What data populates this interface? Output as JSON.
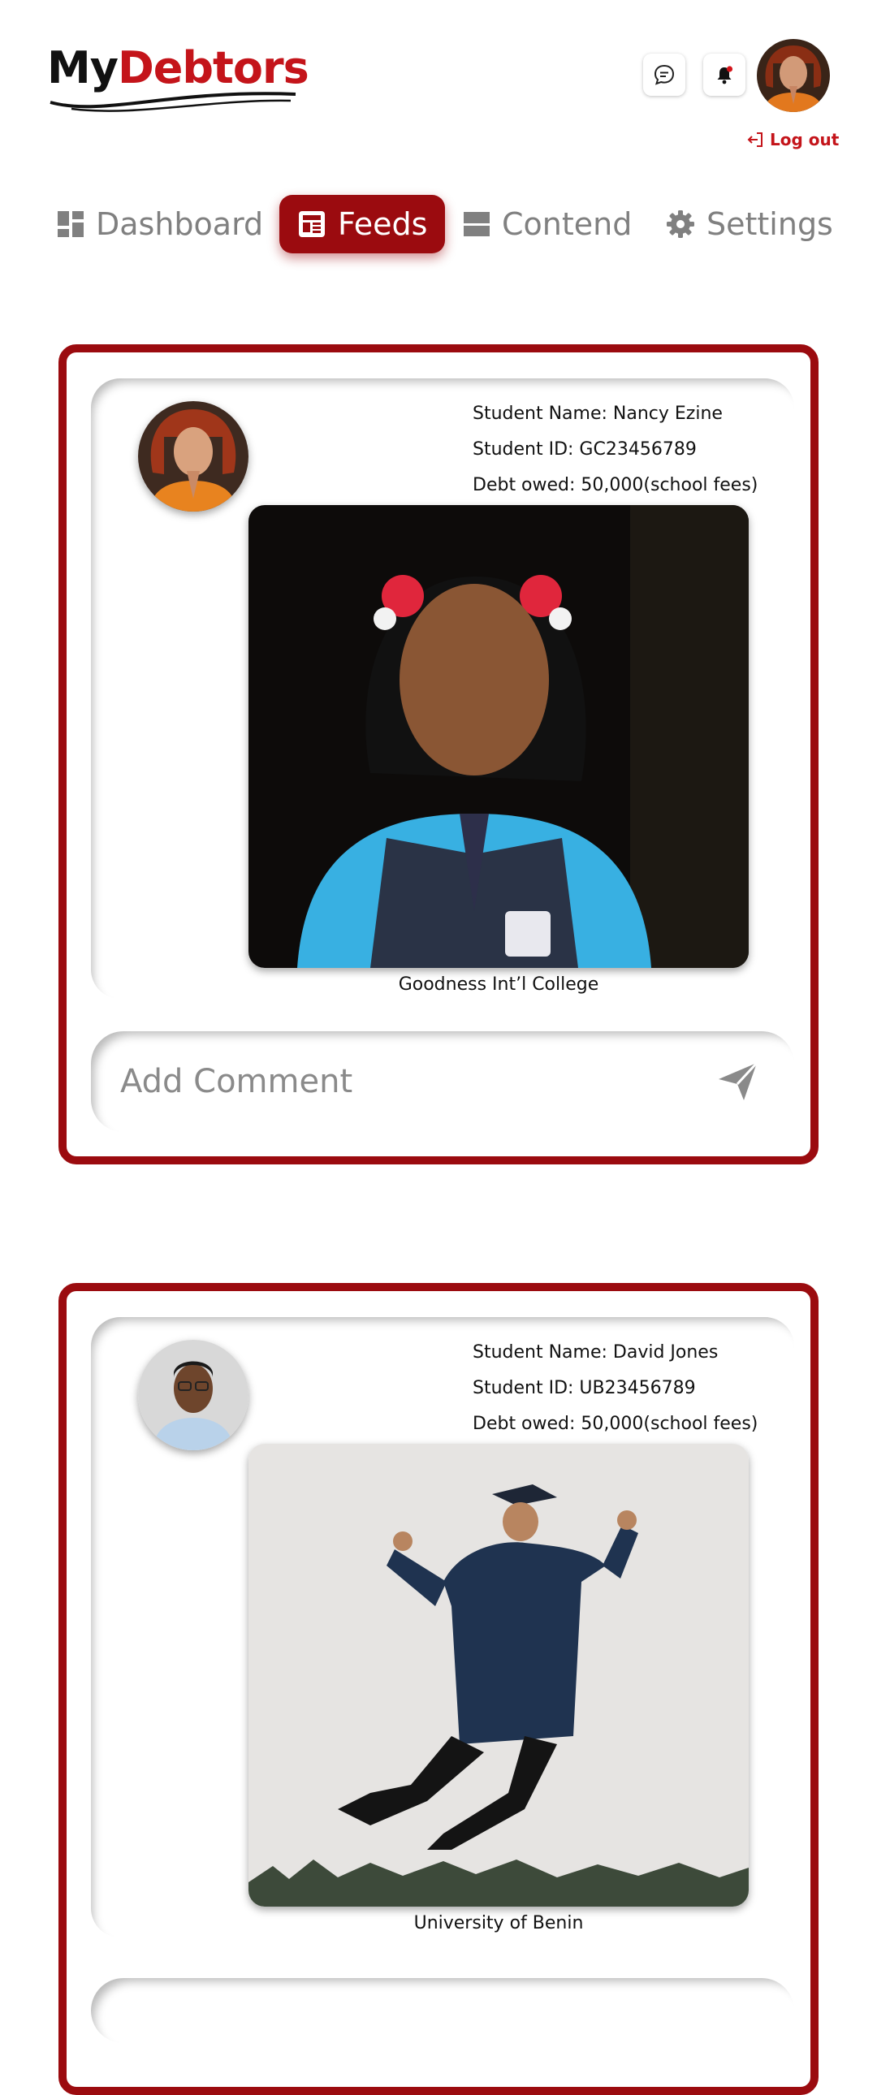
{
  "header": {
    "logo_my": "My",
    "logo_debtors": "Debtors",
    "logout_label": "Log out"
  },
  "nav": {
    "items": [
      {
        "label": "Dashboard",
        "icon": "dashboard-icon"
      },
      {
        "label": "Feeds",
        "icon": "feeds-icon",
        "active": true
      },
      {
        "label": "Contend",
        "icon": "contend-icon"
      },
      {
        "label": "Settings",
        "icon": "gear-icon"
      }
    ]
  },
  "posts": [
    {
      "student_name": "Student Name: Nancy Ezine",
      "student_id": "Student ID: GC23456789",
      "debt": "Debt owed: 50,000(school fees)",
      "school": "Goodness Int’l College",
      "comment_placeholder": "Add Comment"
    },
    {
      "student_name": "Student Name: David Jones",
      "student_id": "Student ID: UB23456789",
      "debt": "Debt owed: 50,000(school fees)",
      "school": "University of Benin"
    }
  ],
  "colors": {
    "brand_red": "#9b0b0f",
    "logo_red": "#c4141a",
    "muted_text": "#808080"
  }
}
